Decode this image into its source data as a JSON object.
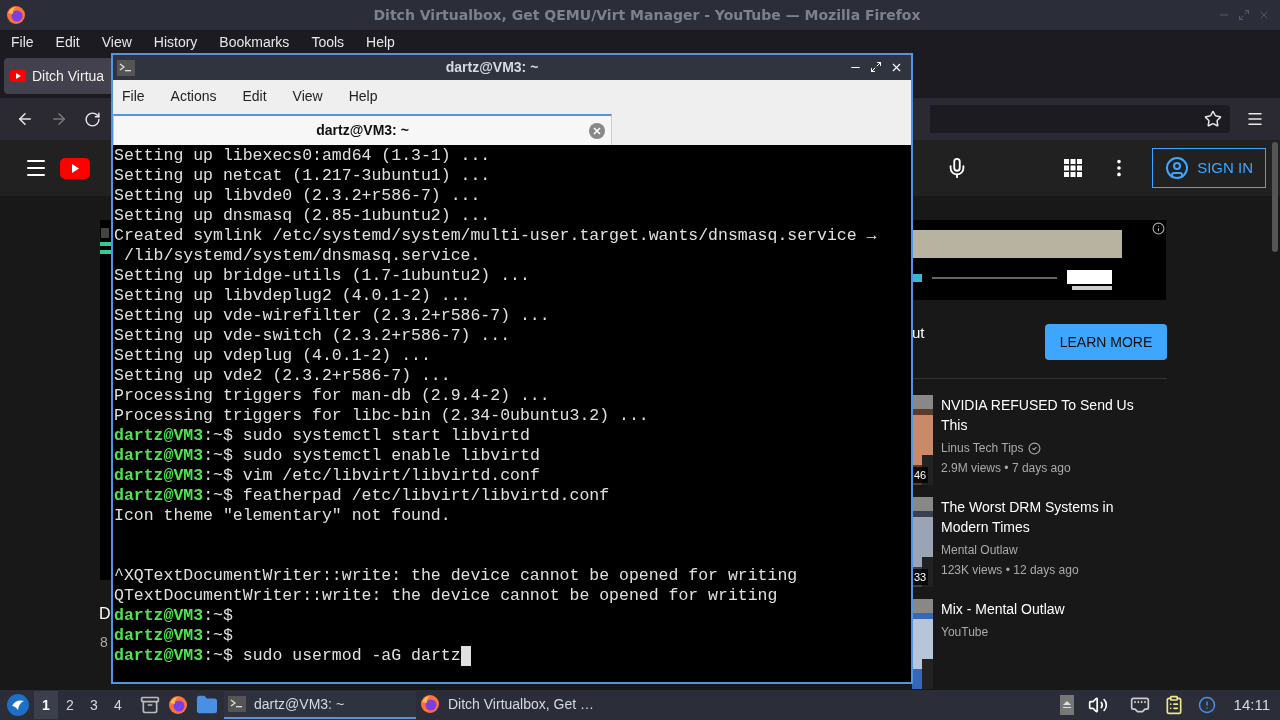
{
  "firefox": {
    "title": "Ditch Virtualbox, Get QEMU/Virt Manager - YouTube — Mozilla Firefox",
    "menu": [
      "File",
      "Edit",
      "View",
      "History",
      "Bookmarks",
      "Tools",
      "Help"
    ],
    "tab": {
      "title": "Ditch Virtua"
    }
  },
  "youtube": {
    "sign_in": "SIGN IN",
    "video_title": "D",
    "video_meta": "8",
    "ad_text": "ut",
    "ad_button": "LEARN MORE",
    "recommendations": [
      {
        "title": "NVIDIA REFUSED To Send Us This",
        "channel": "Linus Tech Tips",
        "verified": true,
        "meta": "2.9M views • 7 days ago",
        "duration": "46"
      },
      {
        "title": "The Worst DRM Systems in Modern Times",
        "channel": "Mental Outlaw",
        "verified": false,
        "meta": "123K views • 12 days ago",
        "duration": "33"
      },
      {
        "title": "Mix - Mental Outlaw",
        "channel": "YouTube",
        "verified": false
      }
    ]
  },
  "terminal": {
    "title": "dartz@VM3: ~",
    "menu": [
      "File",
      "Actions",
      "Edit",
      "View",
      "Help"
    ],
    "tab": "dartz@VM3: ~",
    "lines": [
      {
        "kind": "output",
        "text": "Setting up libexecs0:amd64 (1.3-1) ..."
      },
      {
        "kind": "output",
        "text": "Setting up netcat (1.217-3ubuntu1) ..."
      },
      {
        "kind": "output",
        "text": "Setting up libvde0 (2.3.2+r586-7) ..."
      },
      {
        "kind": "output",
        "text": "Setting up dnsmasq (2.85-1ubuntu2) ..."
      },
      {
        "kind": "output",
        "text": "Created symlink /etc/systemd/system/multi-user.target.wants/dnsmasq.service →"
      },
      {
        "kind": "output",
        "text": " /lib/systemd/system/dnsmasq.service."
      },
      {
        "kind": "output",
        "text": "Setting up bridge-utils (1.7-1ubuntu2) ..."
      },
      {
        "kind": "output",
        "text": "Setting up libvdeplug2 (4.0.1-2) ..."
      },
      {
        "kind": "output",
        "text": "Setting up vde-wirefilter (2.3.2+r586-7) ..."
      },
      {
        "kind": "output",
        "text": "Setting up vde-switch (2.3.2+r586-7) ..."
      },
      {
        "kind": "output",
        "text": "Setting up vdeplug (4.0.1-2) ..."
      },
      {
        "kind": "output",
        "text": "Setting up vde2 (2.3.2+r586-7) ..."
      },
      {
        "kind": "output",
        "text": "Processing triggers for man-db (2.9.4-2) ..."
      },
      {
        "kind": "output",
        "text": "Processing triggers for libc-bin (2.34-0ubuntu3.2) ..."
      },
      {
        "kind": "prompt",
        "user": "dartz@VM3",
        "path": ":~$",
        "command": "sudo systemctl start libvirtd"
      },
      {
        "kind": "prompt",
        "user": "dartz@VM3",
        "path": ":~$",
        "command": "sudo systemctl enable libvirtd"
      },
      {
        "kind": "prompt",
        "user": "dartz@VM3",
        "path": ":~$",
        "command": "vim /etc/libvirt/libvirtd.conf"
      },
      {
        "kind": "prompt",
        "user": "dartz@VM3",
        "path": ":~$",
        "command": "featherpad /etc/libvirt/libvirtd.conf"
      },
      {
        "kind": "output",
        "text": "Icon theme \"elementary\" not found."
      },
      {
        "kind": "blank"
      },
      {
        "kind": "blank"
      },
      {
        "kind": "output",
        "text": "^XQTextDocumentWriter::write: the device cannot be opened for writing"
      },
      {
        "kind": "output",
        "text": "QTextDocumentWriter::write: the device cannot be opened for writing"
      },
      {
        "kind": "prompt",
        "user": "dartz@VM3",
        "path": ":~$"
      },
      {
        "kind": "prompt",
        "user": "dartz@VM3",
        "path": ":~$"
      },
      {
        "kind": "prompt",
        "user": "dartz@VM3",
        "path": ":~$",
        "command": "sudo usermod -aG dartz",
        "cursor": true
      }
    ]
  },
  "taskbar": {
    "workspaces": [
      {
        "label": "1",
        "selected": true
      },
      {
        "label": "2",
        "selected": false
      },
      {
        "label": "3",
        "selected": false
      },
      {
        "label": "4",
        "selected": false
      }
    ],
    "tasks": [
      {
        "kind": "terminal",
        "label": "dartz@VM3: ~",
        "selected": true
      },
      {
        "kind": "browser",
        "label": "Ditch Virtualbox, Get …",
        "selected": false
      }
    ],
    "clock": "14:11"
  }
}
